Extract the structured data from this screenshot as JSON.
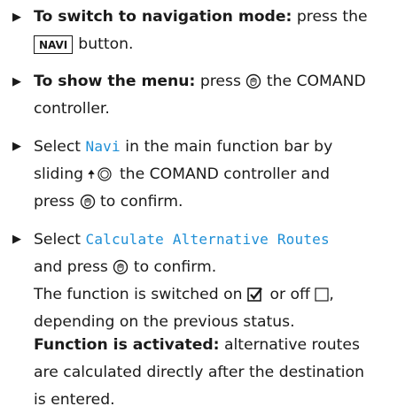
{
  "steps": [
    {
      "bold": "To switch to navigation mode:",
      "text": " press the",
      "key": "NAVI",
      "text2": "button."
    },
    {
      "bold": "To show the menu:",
      "text": " press",
      "text2": "the COMAND",
      "text3": "controller."
    },
    {
      "text": "Select ",
      "mono": "Navi",
      "text2": " in the main function bar by",
      "text3": "sliding",
      "text4": "the COMAND controller and",
      "text5": "press",
      "text6": "to confirm."
    },
    {
      "text": "Select ",
      "mono": "Calculate Alternative Routes",
      "text2": "and press",
      "text3": "to confirm.",
      "text4": "The function is switched on",
      "text5": "or off",
      "text6": ",",
      "text7": "depending on the previous status."
    }
  ],
  "note": {
    "bold": "Function is activated:",
    "text": " alternative routes",
    "line2": "are calculated directly after the destination",
    "line3": "is entered."
  },
  "icons": {
    "press": "press-controller-icon",
    "slide": "slide-up-controller-icon",
    "checked": "checkbox-checked-icon",
    "unchecked": "checkbox-unchecked-icon"
  }
}
